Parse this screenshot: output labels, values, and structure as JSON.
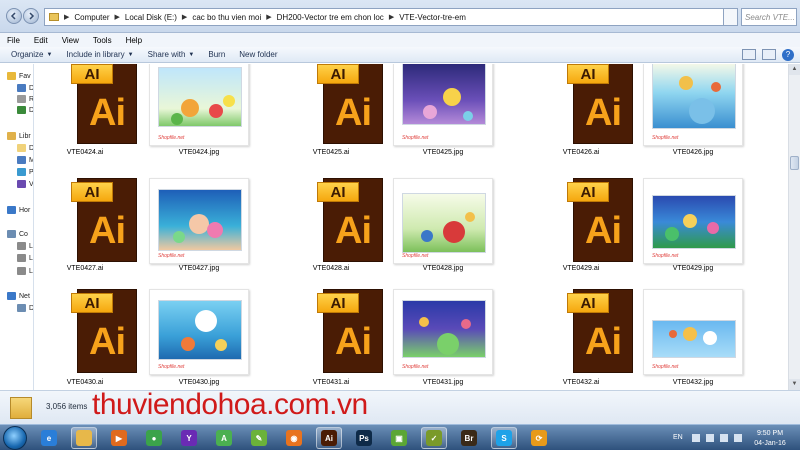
{
  "address_bar": {
    "breadcrumbs": [
      "Computer",
      "Local Disk (E:)",
      "cac bo thu vien moi",
      "DH200-Vector tre em chon loc",
      "VTE-Vector-tre-em"
    ],
    "search_placeholder": "Search VTE..."
  },
  "menu": [
    "File",
    "Edit",
    "View",
    "Tools",
    "Help"
  ],
  "toolbar": {
    "organize": "Organize",
    "include_library": "Include in library",
    "share_with": "Share with",
    "burn": "Burn",
    "new_folder": "New folder"
  },
  "nav_pane": [
    {
      "label": "Fav",
      "icon": "star-icon"
    },
    {
      "label": "D",
      "icon": "desktop-icon"
    },
    {
      "label": "R",
      "icon": "recent-icon"
    },
    {
      "label": "D",
      "icon": "downloads-icon"
    },
    {
      "label": "Libr",
      "icon": "library-icon"
    },
    {
      "label": "D",
      "icon": "documents-icon"
    },
    {
      "label": "M",
      "icon": "music-icon"
    },
    {
      "label": "P",
      "icon": "pictures-icon"
    },
    {
      "label": "V",
      "icon": "videos-icon"
    },
    {
      "label": "Hor",
      "icon": "homegroup-icon"
    },
    {
      "label": "Co",
      "icon": "computer-icon"
    },
    {
      "label": "L",
      "icon": "drive-icon"
    },
    {
      "label": "L",
      "icon": "drive-icon"
    },
    {
      "label": "L",
      "icon": "drive-icon"
    },
    {
      "label": "Net",
      "icon": "network-icon"
    },
    {
      "label": "D",
      "icon": "network-computer-icon"
    }
  ],
  "files": [
    {
      "name": "VTE0424.ai",
      "type": "ai"
    },
    {
      "name": "VTE0424.jpg",
      "type": "jpg",
      "scene": "sky",
      "wm": "Shopfile.net"
    },
    {
      "name": "VTE0425.ai",
      "type": "ai"
    },
    {
      "name": "VTE0425.jpg",
      "type": "jpg",
      "scene": "night",
      "wm": "Shopfile.net"
    },
    {
      "name": "VTE0426.ai",
      "type": "ai"
    },
    {
      "name": "VTE0426.jpg",
      "type": "jpg",
      "scene": "sea",
      "wm": "Shopfile.net"
    },
    {
      "name": "VTE0427.ai",
      "type": "ai"
    },
    {
      "name": "VTE0427.jpg",
      "type": "jpg",
      "scene": "ocean",
      "wm": "Shopfile.net"
    },
    {
      "name": "VTE0428.ai",
      "type": "ai"
    },
    {
      "name": "VTE0428.jpg",
      "type": "jpg",
      "scene": "garden",
      "wm": "Shopfile.net"
    },
    {
      "name": "VTE0429.ai",
      "type": "ai"
    },
    {
      "name": "VTE0429.jpg",
      "type": "jpg",
      "scene": "forest",
      "wm": "Shopfile.net"
    },
    {
      "name": "VTE0430.ai",
      "type": "ai"
    },
    {
      "name": "VTE0430.jpg",
      "type": "jpg",
      "scene": "sail",
      "wm": "Shopfile.net"
    },
    {
      "name": "VTE0431.ai",
      "type": "ai"
    },
    {
      "name": "VTE0431.jpg",
      "type": "jpg",
      "scene": "space",
      "wm": "Shopfile.net"
    },
    {
      "name": "VTE0432.ai",
      "type": "ai"
    },
    {
      "name": "VTE0432.jpg",
      "type": "jpg",
      "scene": "cloud",
      "wm": "Shopfile.net"
    }
  ],
  "ai_icon": {
    "tab_text": "AI",
    "big_text": "Ai"
  },
  "details": {
    "item_count": "3,056 items"
  },
  "watermark": "thuviendohoa.com.vn",
  "taskbar": {
    "apps": [
      {
        "name": "ie-icon",
        "label": "e",
        "color": "#2a7ed8"
      },
      {
        "name": "explorer-icon",
        "label": "",
        "color": "#e7b84a",
        "active": true
      },
      {
        "name": "media-player-icon",
        "label": "▶",
        "color": "#e06a1e"
      },
      {
        "name": "chrome-icon",
        "label": "●",
        "color": "#3ba34a"
      },
      {
        "name": "yahoo-icon",
        "label": "Y",
        "color": "#6a2bb4"
      },
      {
        "name": "android-icon",
        "label": "A",
        "color": "#4bb050"
      },
      {
        "name": "pen-icon",
        "label": "✎",
        "color": "#6bb23a"
      },
      {
        "name": "firefox-icon",
        "label": "◉",
        "color": "#e8731f"
      },
      {
        "name": "illustrator-icon",
        "label": "Ai",
        "color": "#4a1c05",
        "active": true
      },
      {
        "name": "photoshop-icon",
        "label": "Ps",
        "color": "#0e2a48"
      },
      {
        "name": "camtasia-icon",
        "label": "▣",
        "color": "#5ba635"
      },
      {
        "name": "dreamweaver-icon",
        "label": "✓",
        "color": "#7a9a2a",
        "active": true
      },
      {
        "name": "bridge-icon",
        "label": "Br",
        "color": "#3a2a18"
      },
      {
        "name": "skype-icon",
        "label": "S",
        "color": "#1ea2e8",
        "active": true
      },
      {
        "name": "sync-icon",
        "label": "⟳",
        "color": "#e89a1a"
      }
    ],
    "lang": "EN",
    "time": "9:50 PM",
    "date": "04-Jan-16"
  }
}
